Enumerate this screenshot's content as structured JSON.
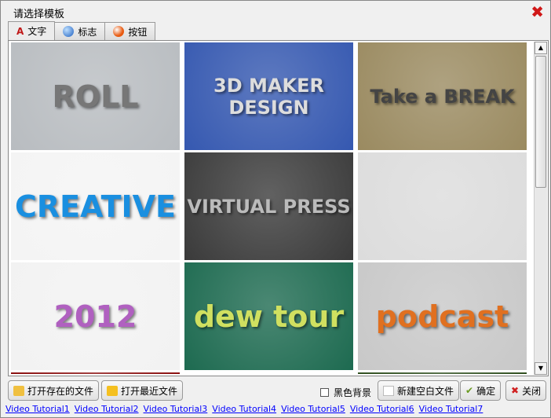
{
  "window": {
    "title": "请选择模板",
    "close_icon": "red-x-icon"
  },
  "tabs": [
    {
      "label": "文字",
      "icon": "text-a-icon",
      "active": true
    },
    {
      "label": "标志",
      "icon": "globe-icon"
    },
    {
      "label": "按钮",
      "icon": "orange-ball-icon"
    }
  ],
  "thumbnails": [
    {
      "text": "ROLL",
      "bg": "#b8bcc0",
      "fg": "#777"
    },
    {
      "text": "3D MAKER DESIGN",
      "bg": "#3558b0",
      "fg": "#ddd"
    },
    {
      "text": "Take a BREAK",
      "bg": "#9a8a60",
      "fg": "#444"
    },
    {
      "text": "CREATIVE",
      "bg": "#f4f4f4",
      "fg": "#1a8fe0"
    },
    {
      "text": "VIRTUAL PRESS",
      "bg": "#3a3a3a",
      "fg": "#bbb"
    },
    {
      "text": "",
      "bg": "#dcdcdc",
      "fg": "#666"
    },
    {
      "text": "2012",
      "bg": "#f2f2f2",
      "fg": "#b060c0"
    },
    {
      "text": "dew tour",
      "bg": "#1d6a50",
      "fg": "#d0e060"
    },
    {
      "text": "podcast",
      "bg": "#c8c8c8",
      "fg": "#e07020"
    },
    {
      "text": "",
      "bg": "#8b1010",
      "fg": "#fff"
    },
    {
      "text": "",
      "bg": "#111",
      "fg": "#fff"
    },
    {
      "text": "",
      "bg": "#2f4f1f",
      "fg": "#fff"
    }
  ],
  "buttons": {
    "open_existing": "打开存在的文件",
    "open_recent": "打开最近文件",
    "black_bg": "黑色背景",
    "new_blank": "新建空白文件",
    "ok": "确定",
    "close": "关闭"
  },
  "black_bg_checked": false,
  "links": [
    "Video Tutorial1",
    "Video Tutorial2",
    "Video Tutorial3",
    "Video Tutorial4",
    "Video Tutorial5",
    "Video Tutorial6",
    "Video Tutorial7"
  ]
}
